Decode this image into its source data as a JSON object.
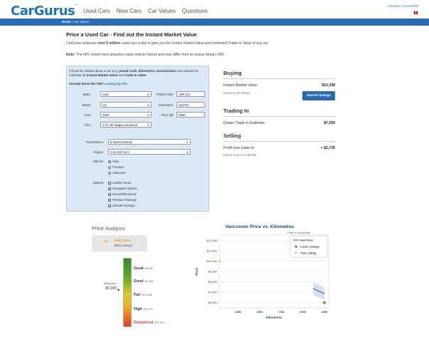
{
  "header": {
    "logo": "CarGurus",
    "nav": [
      "Used Cars",
      "New Cars",
      "Car Values",
      "Questions"
    ],
    "account": "Advertise | GuruD93D"
  },
  "breadcrumb": {
    "home": "Home",
    "sep": "/",
    "current": "Car Values"
  },
  "page": {
    "title": "Price a Used Car - Find out the Instant Market Value",
    "intro_pre": "CarGurus analyzes ",
    "intro_bold": "over 6 million",
    "intro_post": " used cars a day to give you the Instant Market Value and estimated Trade-in Value of any car.",
    "note_label": "Note:",
    "note_text": " The IMV shown here assumes clean vehicle history and may differ from an actual listing's IMV"
  },
  "form": {
    "desc_1": "Fill out the details about a car (e.g. ",
    "desc_b1": "postal code, kilometres, transmission",
    "desc_2": " and options) to calculate its ",
    "desc_b2": "Instant Market Value",
    "desc_3": " and ",
    "desc_b3": "Trade-in Value",
    "vin_q": "Already know the VIN?",
    "vin_link": "Lookup by VIN.",
    "make_label": "Make:",
    "make": "Audi",
    "model_label": "Model:",
    "model": "A3",
    "year_label": "Year:",
    "year": "2006",
    "trim_label": "Trim:",
    "trim": "2.0T 4dr Wagon w/manual",
    "postal_label": "Postal Code:",
    "postal": "V6R 1L3",
    "km_label": "Kilometres:",
    "km": "164703",
    "price_label": "Price ($):",
    "price": "9995",
    "transmission_label": "Transmission:",
    "transmission": "6-Speed Manual",
    "engine_label": "Engine:",
    "engine": "2.0L 200 hp I4",
    "wheels_label": "Wheels:",
    "wheels": [
      "Alloy",
      "Premium",
      "Aluminum"
    ],
    "options_label": "Options:",
    "options": [
      "Leather Seats",
      "Navigation System",
      "Sunroof/Moonroof",
      "Premium Package",
      "Climate Package"
    ]
  },
  "buying": {
    "title": "Buying",
    "imv_label": "Instant Market Value:",
    "imv": "$10,338",
    "based": "Based on 58 listings",
    "search_btn": "Search listings"
  },
  "trading": {
    "title": "Trading In",
    "label": "Dealer Trade-In Estimate:",
    "value": "$7,259"
  },
  "selling": {
    "title": "Selling",
    "label": "Profit over trade-in:",
    "value": "+ $2,736",
    "based": "Based on price of $9,995"
  },
  "analysis": {
    "title": "Price Analysis",
    "deal": "FAIR DEAL",
    "savings": "$343 savings",
    "listing_label": "listing price",
    "listing_value": "$9,995",
    "levels": [
      {
        "name": "Great",
        "price": "$8,062"
      },
      {
        "name": "Good",
        "price": "$9,046"
      },
      {
        "name": "Fair",
        "price": "$10,338"
      },
      {
        "name": "High",
        "price": "$11,371"
      },
      {
        "name": "Overpriced",
        "price": "$12,351+"
      }
    ],
    "colors": {
      "great": "#2d8a2d",
      "fair": "#d7cf2b",
      "over": "#e23b2b"
    }
  },
  "chart_data": {
    "type": "line",
    "title": "Vancouver Price vs. Kilometres",
    "legend_hint": "Click to show/hide",
    "xlabel": "Kilometres",
    "ylabel": "Price",
    "x_ticks": [
      "125k",
      "150k",
      "175k",
      "200k",
      "225k"
    ],
    "x_tick_values": [
      125000,
      150000,
      175000,
      200000,
      225000
    ],
    "xlim": [
      103000,
      230000
    ],
    "y_ticks": [
      "$6,000",
      "$7,000",
      "$8,000",
      "$9,000",
      "$10,000",
      "$11,000",
      "$12,000"
    ],
    "y_tick_values": [
      6000,
      7000,
      8000,
      9000,
      10000,
      11000,
      12000
    ],
    "ylim": [
      5500,
      12500
    ],
    "legend": [
      "Fair Price",
      "Local Listings",
      "This Listing"
    ],
    "series": [
      {
        "name": "Fair Price",
        "x": [
          212000,
          225000
        ],
        "y": [
          7350,
          6850
        ],
        "band_upper": [
          7950,
          7450
        ],
        "band_lower": [
          6750,
          6250
        ]
      },
      {
        "name": "Local Listings",
        "x": [
          225000
        ],
        "y": [
          6000
        ]
      },
      {
        "name": "This Listing",
        "x": [
          104000
        ],
        "y": [
          9995
        ]
      }
    ],
    "grid": true,
    "legend_position": "top-right"
  }
}
